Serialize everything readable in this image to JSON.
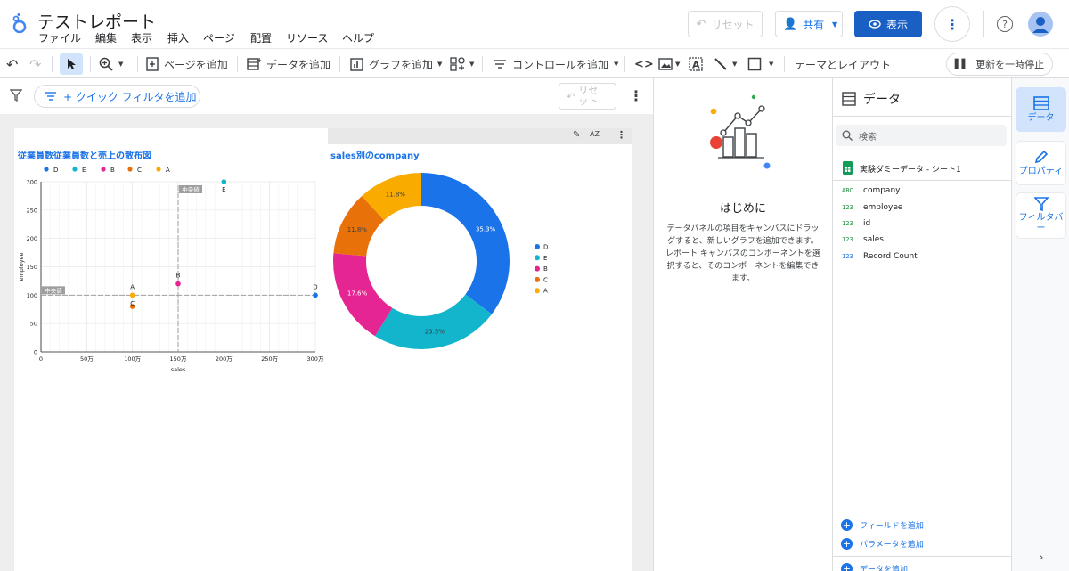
{
  "header": {
    "title": "テストレポート",
    "menu": [
      "ファイル",
      "編集",
      "表示",
      "挿入",
      "ページ",
      "配置",
      "リソース",
      "ヘルプ"
    ],
    "reset_label": "リセット",
    "share_label": "共有",
    "view_label": "表示"
  },
  "toolbar": {
    "add_page": "ページを追加",
    "add_data": "データを追加",
    "add_chart": "グラフを追加",
    "add_control": "コントロールを追加",
    "theme_layout": "テーマとレイアウト",
    "pause_update": "更新を一時停止"
  },
  "filterbar": {
    "quick_filter": "+ クイック フィルタを追加",
    "reset_label": "リセ\nット"
  },
  "scatter": {
    "title": "従業員数従業員数と売上の散布図",
    "xlabel": "sales",
    "ylabel": "employee",
    "median_label": "中央値",
    "legend": [
      "D",
      "E",
      "B",
      "C",
      "A"
    ],
    "x_ticks": [
      "0",
      "50万",
      "100万",
      "150万",
      "200万",
      "250万",
      "300万"
    ],
    "y_ticks": [
      "0",
      "50",
      "100",
      "150",
      "200",
      "250",
      "300"
    ]
  },
  "donut": {
    "title": "sales別のcompany",
    "legend": [
      "D",
      "E",
      "B",
      "C",
      "A"
    ]
  },
  "chart_data": [
    {
      "type": "scatter",
      "title": "従業員数従業員数と売上の散布図",
      "xlabel": "sales",
      "ylabel": "employee",
      "xlim": [
        0,
        3000000
      ],
      "ylim": [
        0,
        300
      ],
      "x_median": 1500000,
      "y_median": 100,
      "series": [
        {
          "name": "D",
          "color": "#1a73e8",
          "points": [
            {
              "x": 3000000,
              "y": 100,
              "label": "D"
            }
          ]
        },
        {
          "name": "E",
          "color": "#12b5cb",
          "points": [
            {
              "x": 2000000,
              "y": 300,
              "label": "E"
            }
          ]
        },
        {
          "name": "B",
          "color": "#e52592",
          "points": [
            {
              "x": 1500000,
              "y": 120,
              "label": "B"
            }
          ]
        },
        {
          "name": "C",
          "color": "#e8710a",
          "points": [
            {
              "x": 1000000,
              "y": 80,
              "label": "C"
            }
          ]
        },
        {
          "name": "A",
          "color": "#f9ab00",
          "points": [
            {
              "x": 1000000,
              "y": 100,
              "label": "A"
            }
          ]
        }
      ],
      "grid": true,
      "legend_position": "top-left"
    },
    {
      "type": "pie",
      "title": "sales別のcompany",
      "slices": [
        {
          "name": "D",
          "value": 35.3,
          "color": "#1a73e8"
        },
        {
          "name": "E",
          "value": 23.5,
          "color": "#12b5cb"
        },
        {
          "name": "B",
          "value": 17.6,
          "color": "#e52592"
        },
        {
          "name": "C",
          "value": 11.8,
          "color": "#e8710a"
        },
        {
          "name": "A",
          "value": 11.8,
          "color": "#f9ab00"
        }
      ],
      "legend_position": "right"
    }
  ],
  "intro": {
    "title": "はじめに",
    "body": "データパネルの項目をキャンバスにドラッグすると、新しいグラフを追加できます。レポート キャンバスのコンポーネントを選択すると、そのコンポーネントを編集できます。"
  },
  "data_panel": {
    "title": "データ",
    "search_placeholder": "検索",
    "source": "実験ダミーデータ - シート1",
    "fields": [
      {
        "type": "ABC",
        "name": "company"
      },
      {
        "type": "123",
        "name": "employee"
      },
      {
        "type": "123",
        "name": "id"
      },
      {
        "type": "123",
        "name": "sales"
      },
      {
        "type": "123",
        "name": "Record Count"
      }
    ],
    "add_field": "フィールドを追加",
    "add_param": "パラメータを追加",
    "add_data": "データを追加"
  },
  "rail": {
    "data": "データ",
    "property": "プロパティ",
    "filterbar": "フィルタバー"
  }
}
